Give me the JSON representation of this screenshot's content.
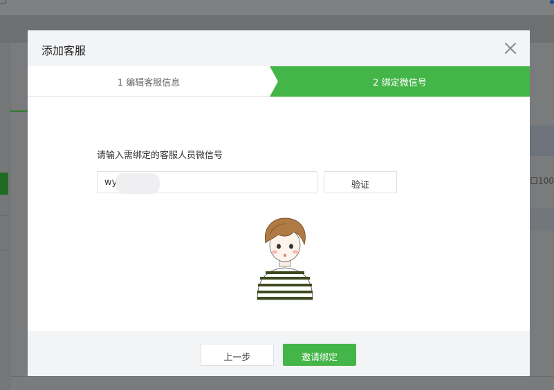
{
  "background": {
    "right_fragment": "⼝100-"
  },
  "dialog": {
    "title": "添加客服",
    "close_icon": "close-icon",
    "steps": [
      {
        "label": "1 编辑客服信息",
        "active": false
      },
      {
        "label": "2 绑定微信号",
        "active": true
      }
    ],
    "prompt": "请输入需绑定的客服人员微信号",
    "wechat_input": {
      "value": "wy"
    },
    "verify_label": "验证",
    "prev_label": "上一步",
    "invite_label": "邀请绑定"
  },
  "colors": {
    "accent_green": "#44b549",
    "overlay": "#7a7b7d"
  }
}
